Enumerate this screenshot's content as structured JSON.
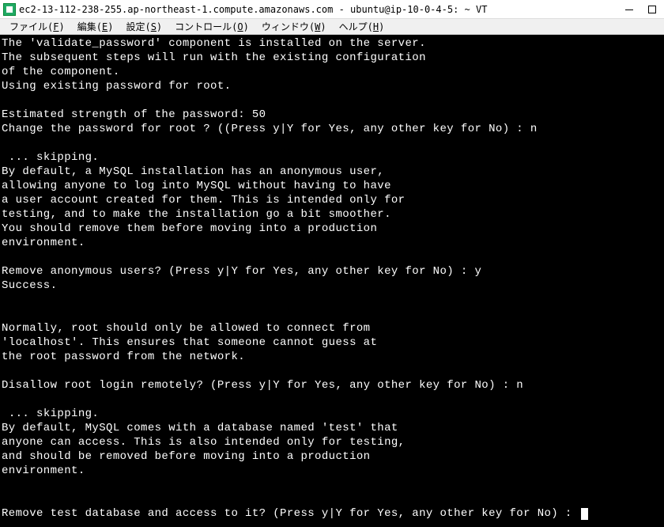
{
  "titlebar": {
    "title": "ec2-13-112-238-255.ap-northeast-1.compute.amazonaws.com - ubuntu@ip-10-0-4-5: ~ VT"
  },
  "menubar": {
    "file": {
      "label": "ファイル",
      "key": "F"
    },
    "edit": {
      "label": "編集",
      "key": "E"
    },
    "setting": {
      "label": "設定",
      "key": "S"
    },
    "control": {
      "label": "コントロール",
      "key": "O"
    },
    "window": {
      "label": "ウィンドウ",
      "key": "W"
    },
    "help": {
      "label": "ヘルプ",
      "key": "H"
    }
  },
  "terminal": {
    "lines": [
      "The 'validate_password' component is installed on the server.",
      "The subsequent steps will run with the existing configuration",
      "of the component.",
      "Using existing password for root.",
      "",
      "Estimated strength of the password: 50",
      "Change the password for root ? ((Press y|Y for Yes, any other key for No) : n",
      "",
      " ... skipping.",
      "By default, a MySQL installation has an anonymous user,",
      "allowing anyone to log into MySQL without having to have",
      "a user account created for them. This is intended only for",
      "testing, and to make the installation go a bit smoother.",
      "You should remove them before moving into a production",
      "environment.",
      "",
      "Remove anonymous users? (Press y|Y for Yes, any other key for No) : y",
      "Success.",
      "",
      "",
      "Normally, root should only be allowed to connect from",
      "'localhost'. This ensures that someone cannot guess at",
      "the root password from the network.",
      "",
      "Disallow root login remotely? (Press y|Y for Yes, any other key for No) : n",
      "",
      " ... skipping.",
      "By default, MySQL comes with a database named 'test' that",
      "anyone can access. This is also intended only for testing,",
      "and should be removed before moving into a production",
      "environment.",
      "",
      ""
    ],
    "prompt_line": "Remove test database and access to it? (Press y|Y for Yes, any other key for No) : "
  }
}
